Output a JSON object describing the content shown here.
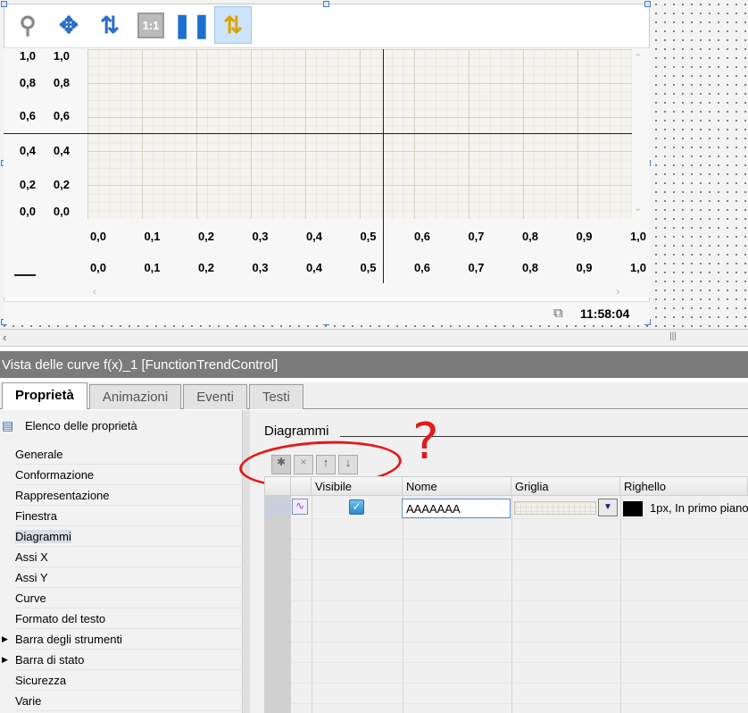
{
  "toolbar": {
    "items": [
      "zoom-area",
      "move",
      "zoom-y-axis",
      "original-size",
      "pause",
      "ruler"
    ],
    "ratio_label": "1:1"
  },
  "chart": {
    "y_ticks": [
      "1,0",
      "0,8",
      "0,6",
      "0,4",
      "0,2",
      "0,0"
    ],
    "x_ticks": [
      "0,0",
      "0,1",
      "0,2",
      "0,3",
      "0,4",
      "0,5",
      "0,6",
      "0,7",
      "0,8",
      "0,9",
      "1,0"
    ]
  },
  "status": {
    "time": "11:58:04"
  },
  "title": "Vista delle curve f(x)_1 [FunctionTrendControl]",
  "tabs": [
    "Proprietà",
    "Animazioni",
    "Eventi",
    "Testi"
  ],
  "left": {
    "header": "Elenco delle proprietà",
    "items": [
      "Generale",
      "Conformazione",
      "Rappresentazione",
      "Finestra",
      "Diagrammi",
      "Assi X",
      "Assi Y",
      "Curve",
      "Formato del testo",
      "Barra degli strumenti",
      "Barra di stato",
      "Sicurezza",
      "Varie"
    ],
    "selected": "Diagrammi"
  },
  "section": {
    "title": "Diagrammi",
    "annotation": "?"
  },
  "table": {
    "headers": [
      "Visibile",
      "Nome",
      "Griglia",
      "Righello"
    ],
    "row": {
      "visible": true,
      "name": "AAAAAAA",
      "ruler": "1px, In primo piano"
    }
  }
}
